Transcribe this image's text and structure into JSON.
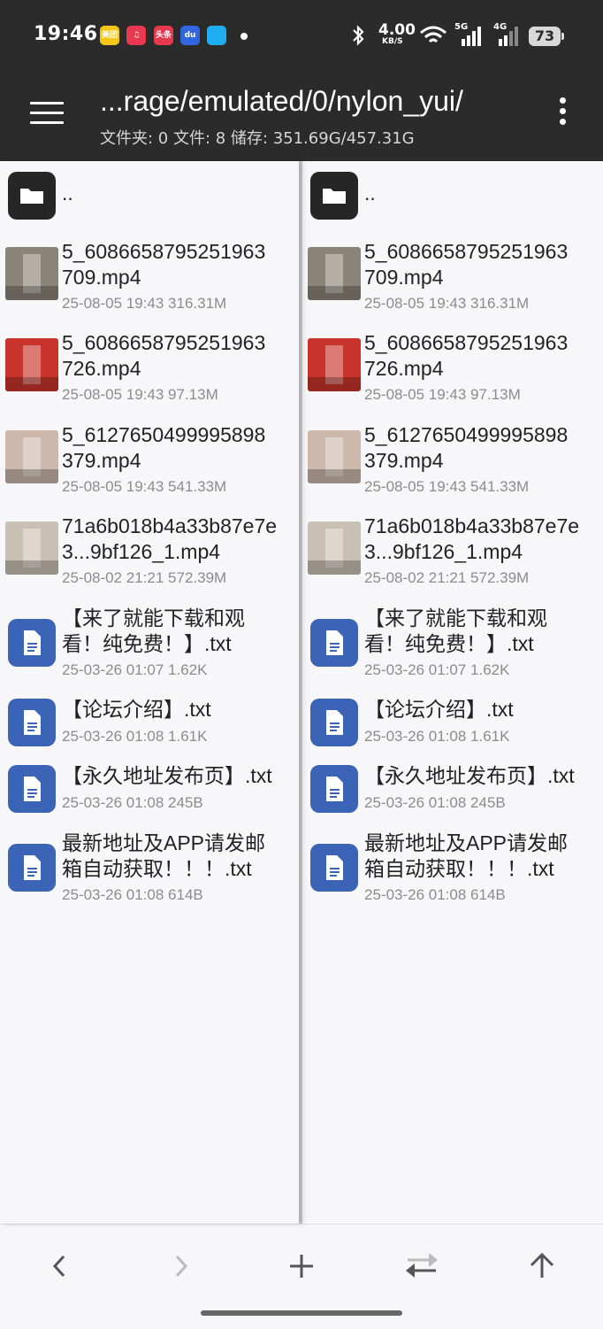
{
  "status_bar": {
    "time": "19:46",
    "app_icons": [
      {
        "name": "meituan-icon",
        "label": "美团",
        "color": "#f5c518"
      },
      {
        "name": "music-icon",
        "label": "♫",
        "color": "#e8384f"
      },
      {
        "name": "toutiao-icon",
        "label": "头条",
        "color": "#e8384f"
      },
      {
        "name": "baidu-icon",
        "label": "du",
        "color": "#3266e0"
      },
      {
        "name": "qq-icon",
        "label": "",
        "color": "#1faef0"
      }
    ],
    "net_speed": "4.00",
    "net_unit": "KB/S",
    "signal1": "5G",
    "signal2": "4G",
    "battery": "73"
  },
  "toolbar": {
    "path": "...rage/emulated/0/nylon_yui/",
    "summary": "文件夹: 0  文件: 8  储存: 351.69G/457.31G"
  },
  "parent_dir": "..",
  "files": [
    {
      "type": "video",
      "line1": "5_6086658795251963",
      "line2": "709.mp4",
      "meta": "25-08-05 19:43  316.31M",
      "thumb": "#8a8478"
    },
    {
      "type": "video",
      "line1": "5_6086658795251963",
      "line2": "726.mp4",
      "meta": "25-08-05 19:43  97.13M",
      "thumb": "#c8332b"
    },
    {
      "type": "video",
      "line1": "5_6127650499995898",
      "line2": "379.mp4",
      "meta": "25-08-05 19:43  541.33M",
      "thumb": "#cdb9ac"
    },
    {
      "type": "video",
      "line1": "71a6b018b4a33b87e7e",
      "line2": "3...9bf126_1.mp4",
      "meta": "25-08-02 21:21  572.39M",
      "thumb": "#c9c0b4"
    },
    {
      "type": "doc",
      "line1": "【来了就能下载和观",
      "line2": "看！纯免费！】.txt",
      "meta": "25-03-26 01:07  1.62K"
    },
    {
      "type": "doc",
      "line1": "【论坛介绍】.txt",
      "line2": "",
      "meta": "25-03-26 01:08  1.61K"
    },
    {
      "type": "doc",
      "line1": "【永久地址发布页】.txt",
      "line2": "",
      "meta": "25-03-26 01:08  245B"
    },
    {
      "type": "doc",
      "line1": "最新地址及APP请发邮",
      "line2": "箱自动获取！！！.txt",
      "meta": "25-03-26 01:08  614B"
    }
  ],
  "bottom_bar": [
    "back-icon",
    "forward-icon",
    "add-icon",
    "swap-icon",
    "up-icon"
  ],
  "colors": {
    "header": "#2b2b2b",
    "doc_icon": "#3b63b6",
    "folder_icon": "#262626"
  }
}
